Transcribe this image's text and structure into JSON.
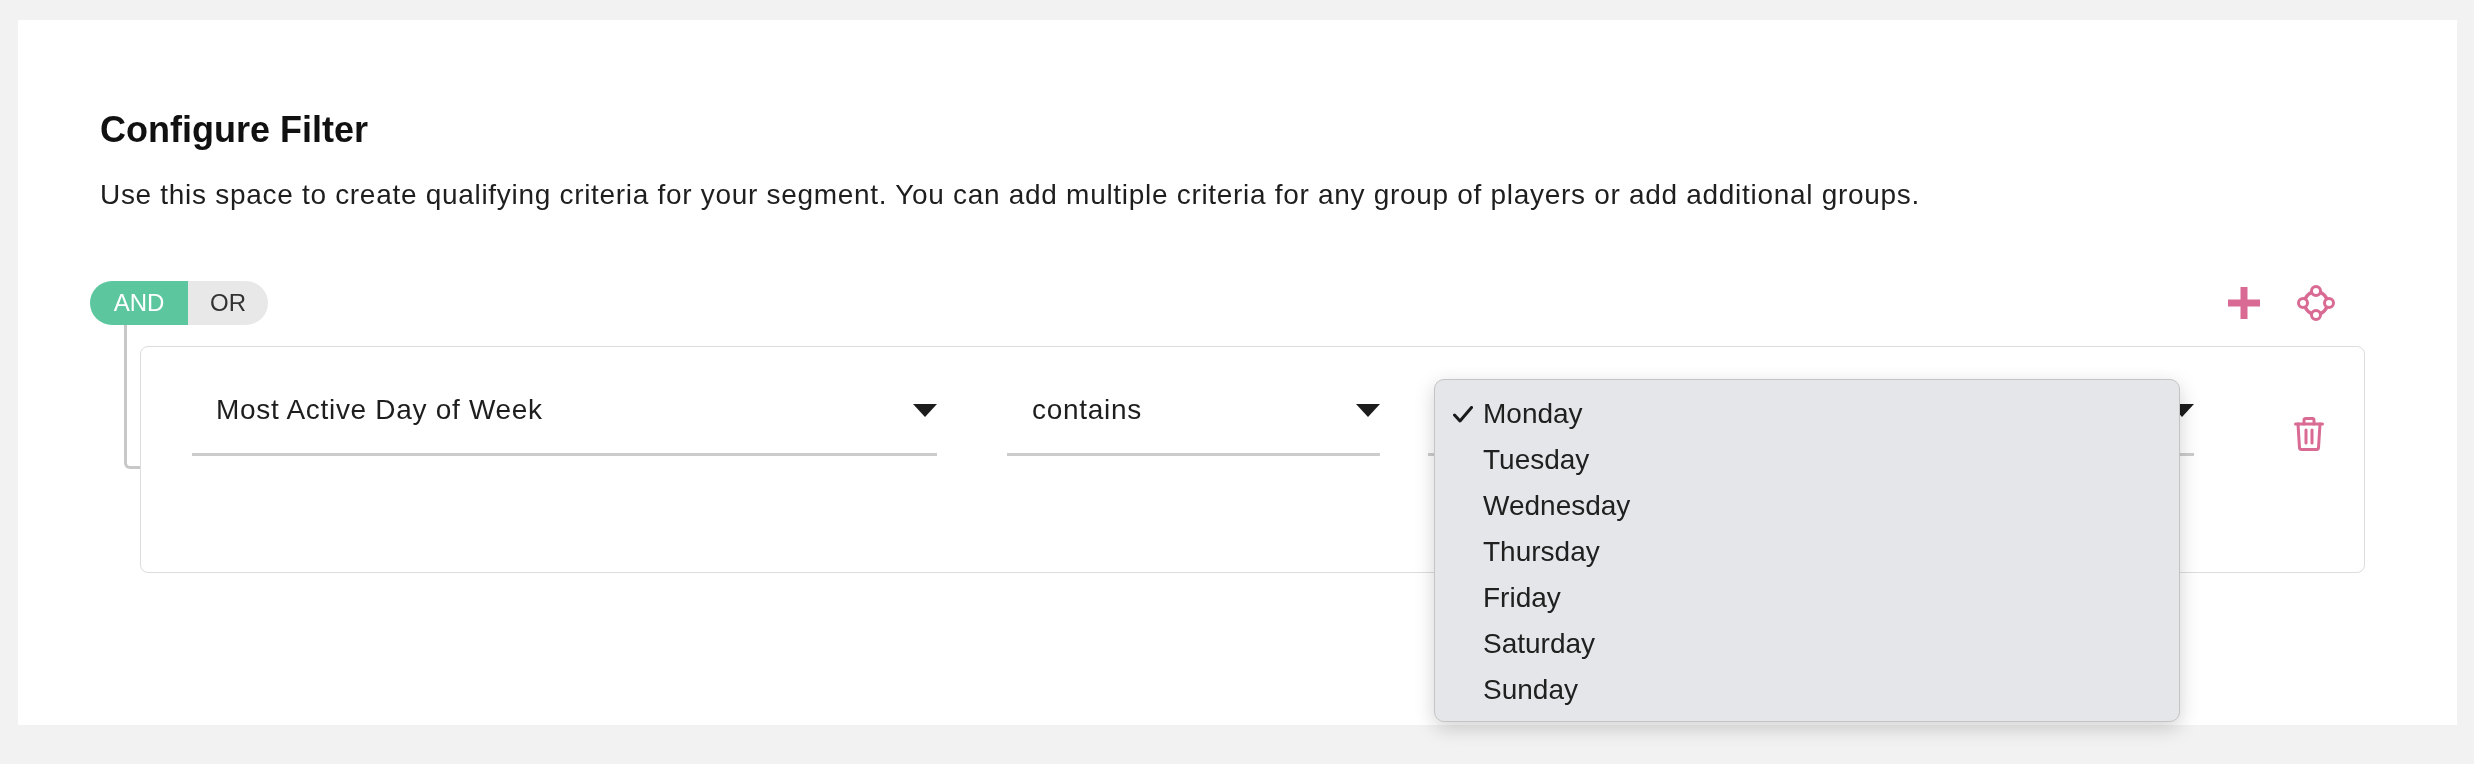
{
  "title": "Configure Filter",
  "description": "Use this space to create qualifying criteria for your segment. You can add multiple criteria for any group of players or add additional groups.",
  "logic_toggle": [
    {
      "label": "AND",
      "selected": true
    },
    {
      "label": "OR",
      "selected": false
    }
  ],
  "filter_group": {
    "conditions": [
      {
        "field": {
          "value": "Most Active Day of Week"
        },
        "operator": {
          "value": "contains"
        },
        "value_select": {
          "expanded": true,
          "options": [
            {
              "label": "Monday",
              "selected": true
            },
            {
              "label": "Tuesday",
              "selected": false
            },
            {
              "label": "Wednesday",
              "selected": false
            },
            {
              "label": "Thursday",
              "selected": false
            },
            {
              "label": "Friday",
              "selected": false
            },
            {
              "label": "Saturday",
              "selected": false
            },
            {
              "label": "Sunday",
              "selected": false
            }
          ]
        }
      }
    ]
  }
}
